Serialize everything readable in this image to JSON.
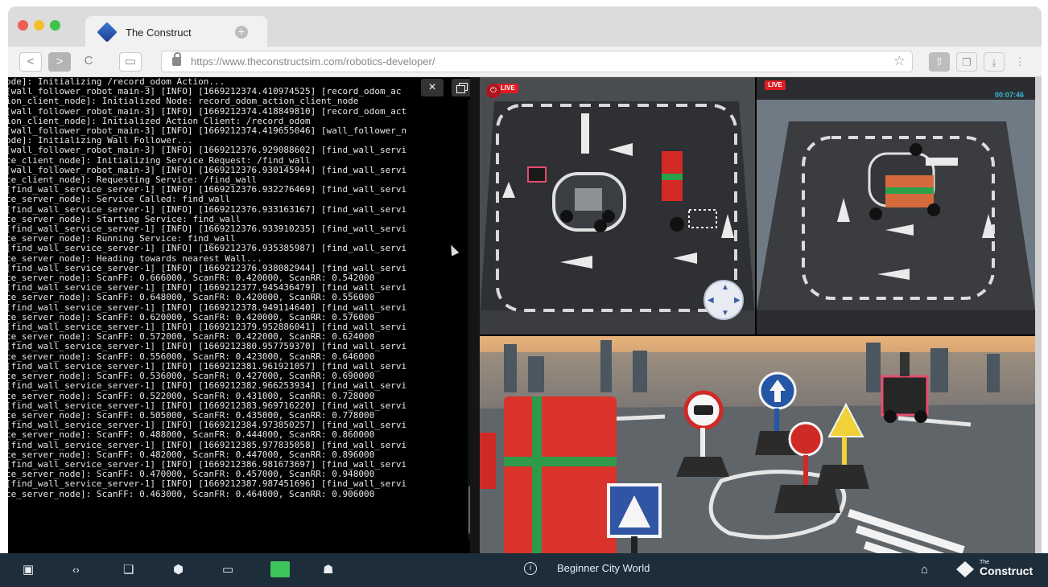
{
  "browser": {
    "tab_title": "The Construct",
    "url": "https://www.theconstructsim.com/robotics-developer/",
    "new_tab_symbol": "+",
    "nav": {
      "back": "<",
      "forward": ">",
      "reload": "C"
    },
    "traffic_lights": [
      "#ec5f55",
      "#f4bc2f",
      "#3ec44b"
    ]
  },
  "terminal": {
    "lines": [
      "ode]: Initializing /record_odom Action...",
      "[wall_follower_robot_main-3] [INFO] [1669212374.410974525] [record_odom_ac",
      "ion_client_node]: Initialized Node: record_odom_action_client_node",
      "[wall_follower_robot_main-3] [INFO] [1669212374.418849810] [record_odom_act",
      "ion_client_node]: Initialized Action Client: /record_odom",
      "[wall_follower_robot_main-3] [INFO] [1669212374.419655046] [wall_follower_n",
      "ode]: Initializing Wall Follower...",
      "[wall_follower_robot_main-3] [INFO] [1669212376.929088602] [find_wall_servi",
      "ce_client_node]: Initializing Service Request: /find_wall",
      "[wall_follower_robot_main-3] [INFO] [1669212376.930145944] [find_wall_servi",
      "ce_client_node]: Requesting Service: /find_wall",
      "[find_wall_service_server-1] [INFO] [1669212376.932276469] [find_wall_servi",
      "ce_server_node]: Service Called: find_wall",
      "[find_wall_service_server-1] [INFO] [1669212376.933163167] [find_wall_servi",
      "ce_server_node]: Starting Service: find_wall",
      "[find_wall_service_server-1] [INFO] [1669212376.933910235] [find_wall_servi",
      "ce_server_node]: Running Service: find_wall",
      "[find_wall_service_server-1] [INFO] [1669212376.935385987] [find_wall_servi",
      "ce_server_node]: Heading towards nearest Wall...",
      "[find_wall_service_server-1] [INFO] [1669212376.938082944] [find_wall_servi",
      "ce_server_node]: ScanFF: 0.666000, ScanFR: 0.420000, ScanRR: 0.542000",
      "[find_wall_service_server-1] [INFO] [1669212377.945436479] [find_wall_servi",
      "ce_server_node]: ScanFF: 0.648000, ScanFR: 0.420000, ScanRR: 0.556000",
      "[find_wall_service_server-1] [INFO] [1669212378.949114640] [find_wall_servi",
      "ce_server_node]: ScanFF: 0.620000, ScanFR: 0.420000, ScanRR: 0.576000",
      "[find_wall_service_server-1] [INFO] [1669212379.952886041] [find_wall_servi",
      "ce_server_node]: ScanFF: 0.572000, ScanFR: 0.422000, ScanRR: 0.624000",
      "[find_wall_service_server-1] [INFO] [1669212380.957759370] [find_wall_servi",
      "ce_server_node]: ScanFF: 0.556000, ScanFR: 0.423000, ScanRR: 0.646000",
      "[find_wall_service_server-1] [INFO] [1669212381.961921057] [find_wall_servi",
      "ce_server_node]: ScanFF: 0.536000, ScanFR: 0.427000, ScanRR: 0.690000",
      "[find_wall_service_server-1] [INFO] [1669212382.966253934] [find_wall_servi",
      "ce_server_node]: ScanFF: 0.522000, ScanFR: 0.431000, ScanRR: 0.728000",
      "[find_wall_service_server-1] [INFO] [1669212383.969716220] [find_wall_servi",
      "ce_server_node]: ScanFF: 0.505000, ScanFR: 0.435000, ScanRR: 0.778000",
      "[find_wall_service_server-1] [INFO] [1669212384.973850257] [find_wall_servi",
      "ce_server_node]: ScanFF: 0.488000, ScanFR: 0.444000, ScanRR: 0.860000",
      "[find_wall_service_server-1] [INFO] [1669212385.977835058] [find_wall_servi",
      "ce_server_node]: ScanFF: 0.482000, ScanFR: 0.447000, ScanRR: 0.896000",
      "[find_wall_service_server-1] [INFO] [1669212386.981673697] [find_wall_servi",
      "ce_server_node]: ScanFF: 0.470000, ScanFR: 0.457000, ScanRR: 0.948000",
      "[find_wall_service_server-1] [INFO] [1669212387.987451696] [find_wall_servi",
      "ce_server_node]: ScanFF: 0.463000, ScanFR: 0.464000, ScanRR: 0.906000"
    ],
    "close_symbol": "×"
  },
  "cameras": {
    "feed1_badge": "LIVE",
    "feed2_badge": "LIVE",
    "feed2_timer": "00:07:46",
    "power_symbol": "⏻"
  },
  "bottom_bar": {
    "world_name": "Beginner City World",
    "info_symbol": "i",
    "brand_prefix": "The",
    "brand_name": "Construct",
    "icons": [
      "terminal-icon",
      "code-icon",
      "notebook-icon",
      "cube-icon",
      "desktop-icon",
      "book-icon",
      "robot-icon",
      "home-icon"
    ]
  },
  "colors": {
    "bottom_bar": "#1d2d3a",
    "live": "#e01b24",
    "timer": "#3ab8d8",
    "book_icon": "#3cc45a"
  }
}
